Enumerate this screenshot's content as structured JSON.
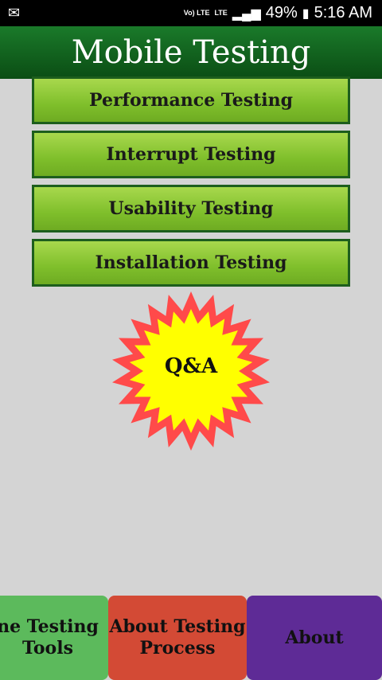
{
  "status_bar": {
    "notification_icon": "email-icon",
    "volte": "Vo) LTE",
    "lte": "LTE",
    "battery": "49%",
    "time": "5:16 AM"
  },
  "app_bar": {
    "title": "Mobile Testing"
  },
  "menu": [
    {
      "label": "Performance Testing"
    },
    {
      "label": "Interrupt Testing"
    },
    {
      "label": "Usability Testing"
    },
    {
      "label": "Installation Testing"
    }
  ],
  "qa_badge": {
    "label": "Q&A",
    "colors": {
      "outer": "#ff4a4a",
      "inner": "#ffff00"
    }
  },
  "bottom_nav": [
    {
      "label_line1": "ne Testing",
      "label_line2": "Tools"
    },
    {
      "label_line1": "About Testing",
      "label_line2": "Process"
    },
    {
      "label_line1": "About",
      "label_line2": ""
    }
  ],
  "colors": {
    "app_bar": "#0b4d14",
    "menu_button": "#7fbf2b",
    "tab1": "#5cba5c",
    "tab2": "#d34a35",
    "tab3": "#5e2b96"
  }
}
